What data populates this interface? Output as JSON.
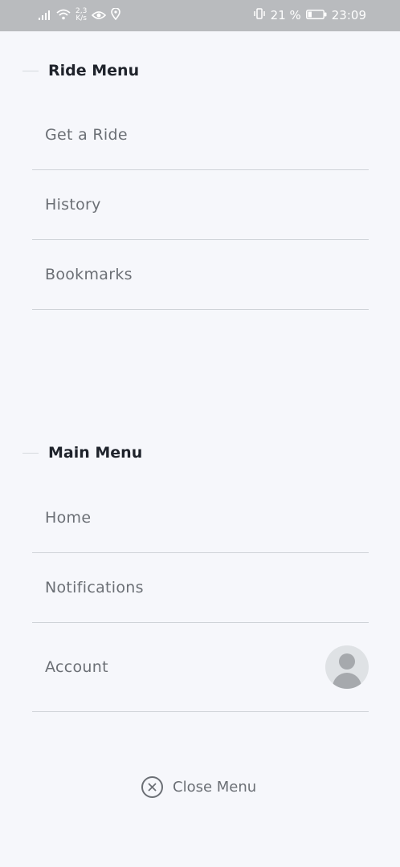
{
  "status_bar": {
    "network_speed_value": "2,3",
    "network_speed_unit": "K/s",
    "battery_percent": "21 %",
    "time": "23:09"
  },
  "ride_menu": {
    "title": "Ride Menu",
    "items": [
      {
        "label": "Get a Ride"
      },
      {
        "label": "History"
      },
      {
        "label": "Bookmarks"
      }
    ]
  },
  "main_menu": {
    "title": "Main Menu",
    "items": [
      {
        "label": "Home"
      },
      {
        "label": "Notifications"
      },
      {
        "label": "Account"
      }
    ]
  },
  "close_menu": {
    "label": "Close Menu"
  },
  "icons": {
    "close": "close-circle-icon",
    "avatar": "user-avatar-icon"
  },
  "colors": {
    "background": "#f6f7fb",
    "status_bar": "#b9bbbe",
    "heading_text": "#1f232b",
    "item_text": "#6b6f75",
    "divider": "#cfd3d8"
  }
}
